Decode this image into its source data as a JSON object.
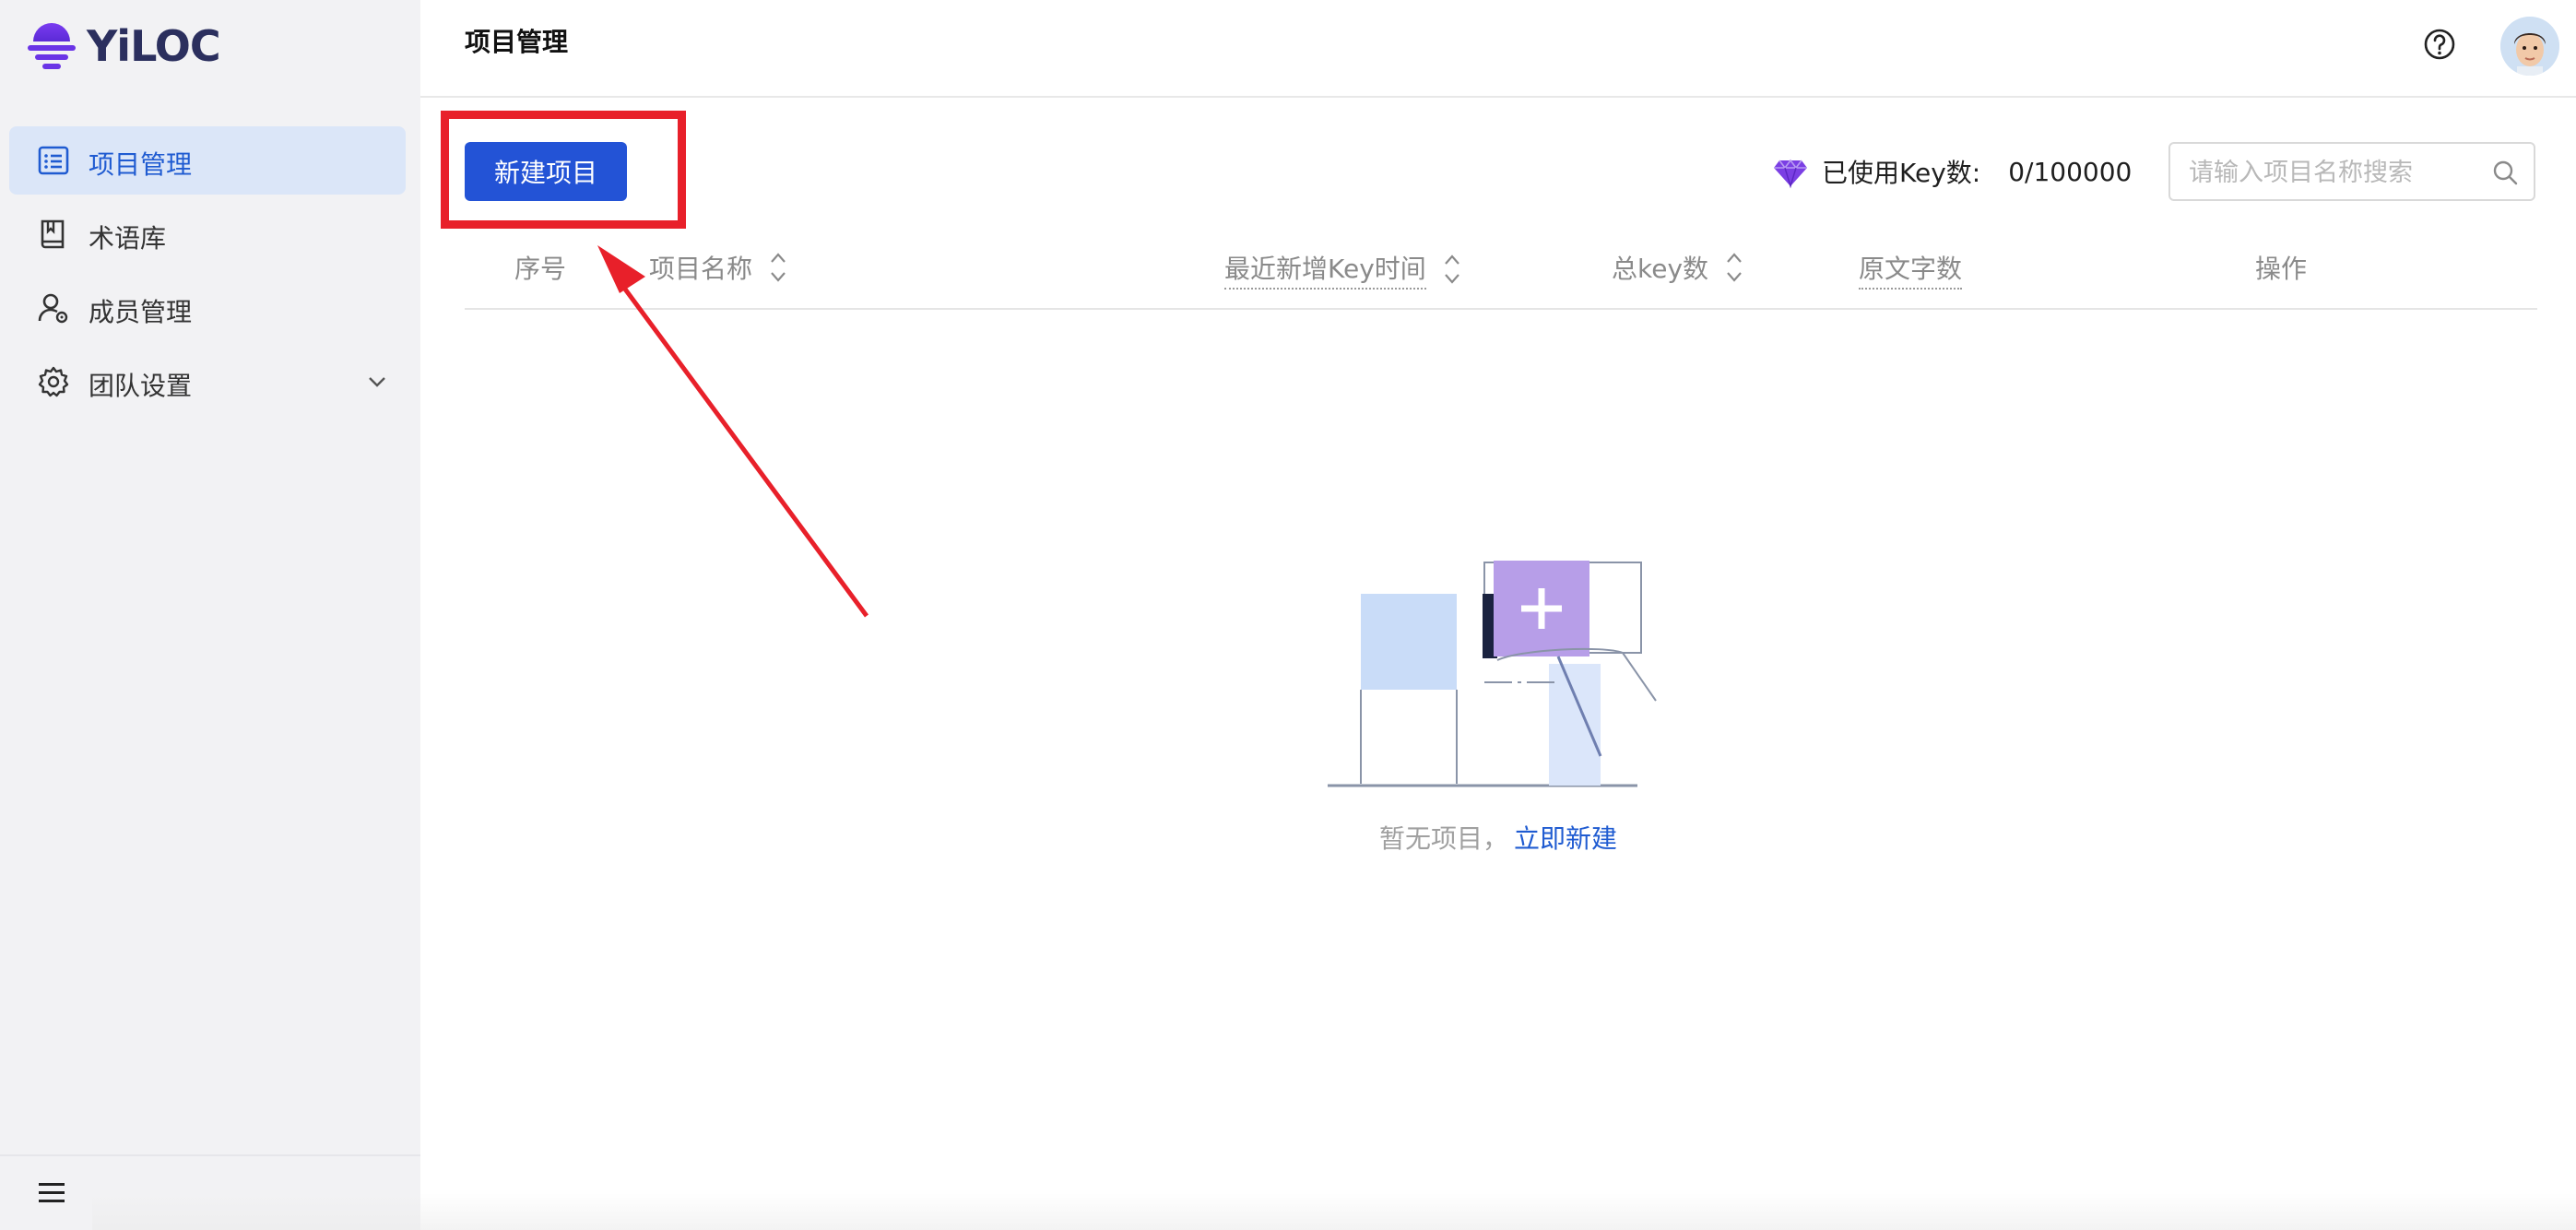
{
  "brand": {
    "logo_text": "YiLOC"
  },
  "sidebar": {
    "items": [
      {
        "label": "项目管理",
        "icon": "project-list-icon",
        "active": true
      },
      {
        "label": "术语库",
        "icon": "book-icon"
      },
      {
        "label": "成员管理",
        "icon": "member-settings-icon"
      },
      {
        "label": "团队设置",
        "icon": "gear-icon",
        "expandable": true
      }
    ],
    "footer_icon": "hamburger-menu-icon"
  },
  "header": {
    "title": "项目管理",
    "help_icon": "help-circle-icon",
    "avatar_icon": "user-avatar"
  },
  "toolbar": {
    "create_button_label": "新建项目",
    "key_usage_label": "已使用Key数:",
    "key_usage_count": "0/100000",
    "gem_icon": "diamond-icon",
    "search_placeholder": "请输入项目名称搜索"
  },
  "table": {
    "columns": [
      {
        "label": "序号"
      },
      {
        "label": "项目名称",
        "sortable": true
      },
      {
        "label": "最近新增Key时间",
        "sortable": true,
        "dotted": true
      },
      {
        "label": "总key数",
        "sortable": true
      },
      {
        "label": "原文字数",
        "dotted": true
      },
      {
        "label": "操作"
      }
    ]
  },
  "empty_state": {
    "text": "暂无项目，",
    "link": "立即新建"
  },
  "colors": {
    "primary": "#2353d6",
    "link": "#1f5bd1",
    "sidebar_bg": "#f2f2f4",
    "active_bg": "#dbe6f8",
    "annotation_red": "#e8202a",
    "gem_purple": "#7b3fe4"
  }
}
